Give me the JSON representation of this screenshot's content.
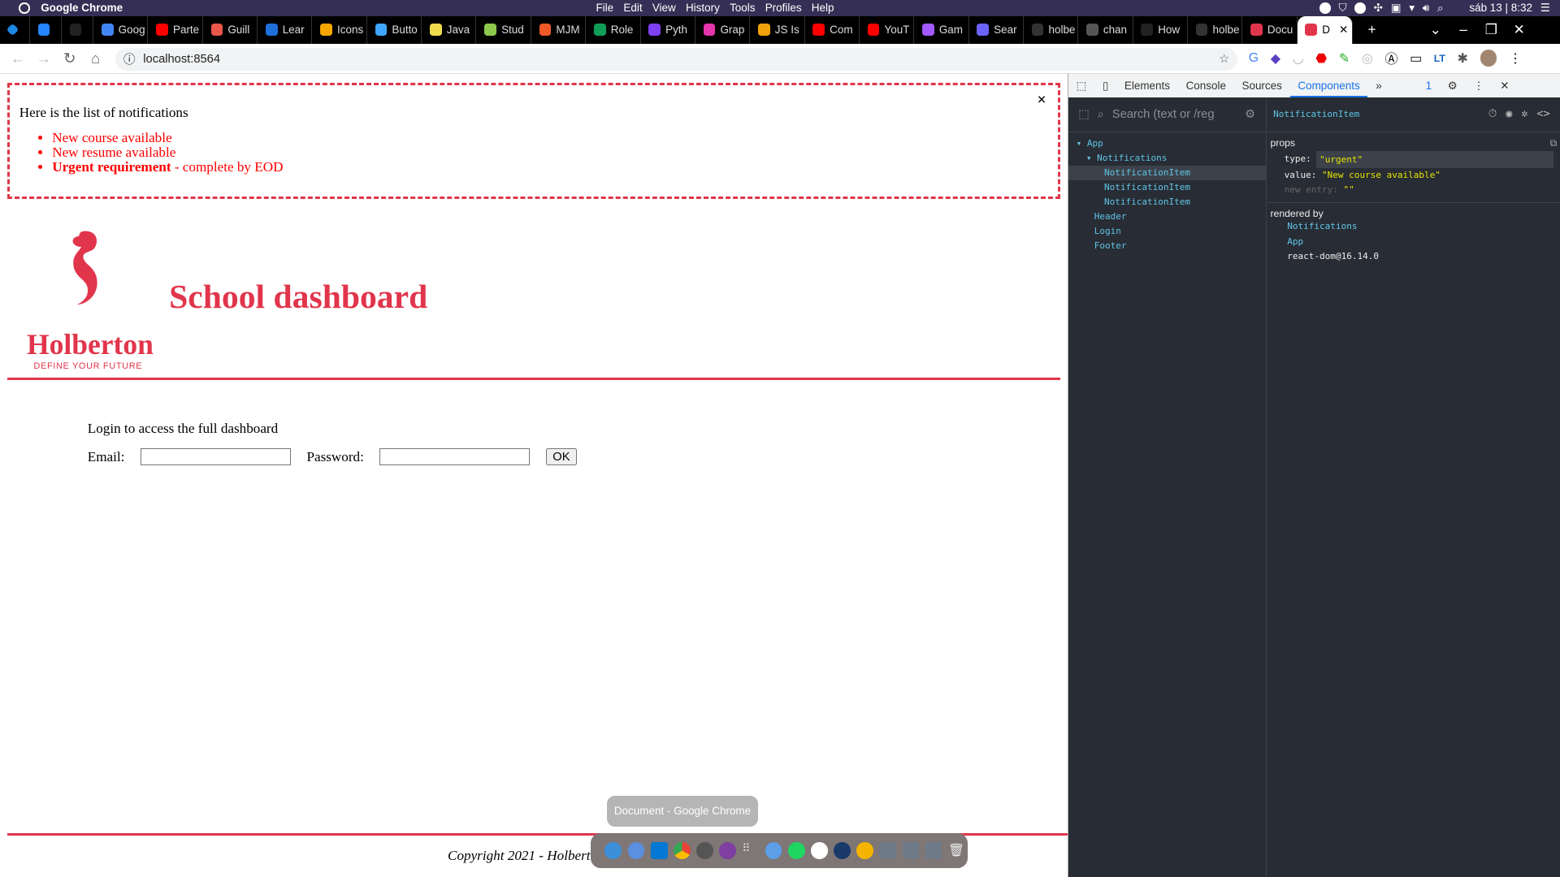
{
  "os_bar": {
    "app_name": "Google Chrome",
    "menu": [
      "File",
      "Edit",
      "View",
      "History",
      "Tools",
      "Profiles",
      "Help"
    ],
    "clock": "sáb 13 | 8:32"
  },
  "tabs": [
    "Goog",
    "Parte",
    "Guill",
    "Lear",
    "Icons",
    "Butto",
    "Java",
    "Stud",
    "MJM",
    "Role",
    "Pyth",
    "Grap",
    "JS Is",
    "Com",
    "YouT",
    "Gam",
    "Sear",
    "holbe",
    "chan",
    "How",
    "holbe",
    "Docu"
  ],
  "active_tab": "D",
  "tab_colors": [
    "#4285f4",
    "#f00",
    "#e8574a",
    "#1e6fd9",
    "#f7a600",
    "#3ea6ff",
    "#f0db4f",
    "#8cc84b",
    "#f05a28",
    "#0f9d58",
    "#7e3ff2",
    "#e535ab",
    "#f0a30a",
    "#f00",
    "#f00",
    "#a259ff",
    "#6c63ff",
    "#333",
    "#555",
    "#222",
    "#333",
    "#e1354b"
  ],
  "address": "localhost:8564",
  "notifications": {
    "heading": "Here is the list of notifications",
    "items": [
      {
        "text": "New course available"
      },
      {
        "text": "New resume available"
      }
    ],
    "urgent_bold": "Urgent requirement",
    "urgent_rest": " - complete by EOD",
    "close": "×"
  },
  "header": {
    "logo_brand": "Holberton",
    "logo_tagline": "DEFINE YOUR FUTURE",
    "title": "School dashboard"
  },
  "login": {
    "message": "Login to access the full dashboard",
    "email_label": "Email:",
    "password_label": "Password:",
    "email_value": "",
    "password_value": "",
    "ok": "OK"
  },
  "footer": {
    "text": "Copyright 2021 - Holberton"
  },
  "devtools": {
    "tabs": [
      "Elements",
      "Console",
      "Sources",
      "Components"
    ],
    "active": "Components",
    "issues": "1",
    "search_placeholder": "Search (text or /reg",
    "tree": [
      "App",
      "Notifications",
      "NotificationItem",
      "NotificationItem",
      "NotificationItem",
      "Header",
      "Login",
      "Footer"
    ],
    "selected": "NotificationItem",
    "props_label": "props",
    "props": {
      "type_key": "type:",
      "type_val": "\"urgent\"",
      "value_key": "value:",
      "value_val": "\"New course available\"",
      "new_key": "new entry:",
      "new_val": "\"\""
    },
    "rendered_by_label": "rendered by",
    "rendered_by": [
      "Notifications",
      "App",
      "react-dom@16.14.0"
    ]
  },
  "dock": {
    "tooltip": "Document - Google Chrome"
  },
  "colors": {
    "brand": "#e1354b",
    "devtools_bg": "#282c34",
    "os_bar": "#352f55"
  }
}
